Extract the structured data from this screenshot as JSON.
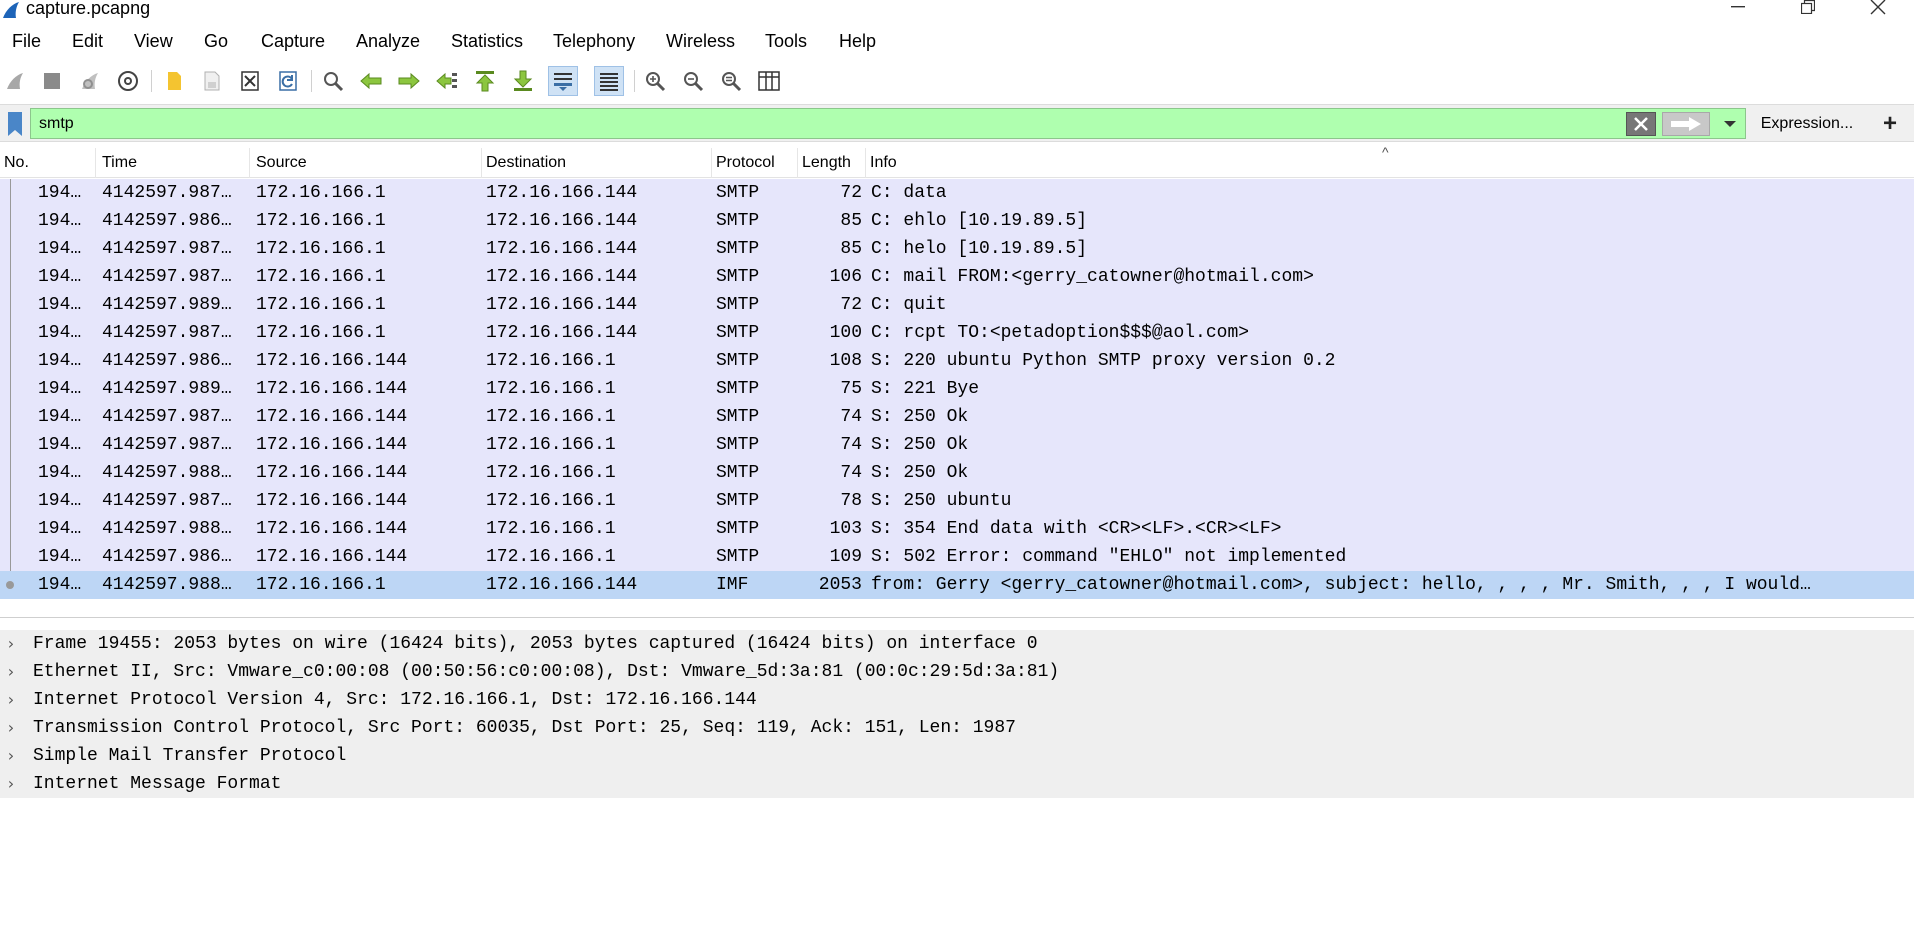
{
  "window": {
    "title": "capture.pcapng",
    "minimize_icon": "minimize-icon",
    "maximize_icon": "restore-icon",
    "close_icon": "close-icon"
  },
  "menu": [
    "File",
    "Edit",
    "View",
    "Go",
    "Capture",
    "Analyze",
    "Statistics",
    "Telephony",
    "Wireless",
    "Tools",
    "Help"
  ],
  "toolbar": {
    "icons": [
      "start-capture-icon",
      "stop-capture-icon",
      "restart-capture-icon",
      "capture-options-icon",
      "open-file-icon",
      "save-file-icon",
      "close-file-icon",
      "reload-file-icon",
      "find-packet-icon",
      "go-back-icon",
      "go-forward-icon",
      "go-to-packet-icon",
      "first-packet-icon",
      "last-packet-icon",
      "auto-scroll-icon",
      "colorize-icon",
      "zoom-in-icon",
      "zoom-out-icon",
      "normal-size-icon",
      "resize-columns-icon"
    ]
  },
  "filter": {
    "value": "smtp",
    "expression_label": "Expression...",
    "add_label": "+",
    "background": "#afffaf"
  },
  "packet_list": {
    "columns": [
      "No.",
      "Time",
      "Source",
      "Destination",
      "Protocol",
      "Length",
      "Info"
    ],
    "row_color": "#e6e6fb",
    "selected_color": "#bdd6f5",
    "rows": [
      {
        "no": "194…",
        "time": "4142597.987…",
        "src": "172.16.166.1",
        "dst": "172.16.166.144",
        "proto": "SMTP",
        "len": "72",
        "info": "C: data"
      },
      {
        "no": "194…",
        "time": "4142597.986…",
        "src": "172.16.166.1",
        "dst": "172.16.166.144",
        "proto": "SMTP",
        "len": "85",
        "info": "C: ehlo [10.19.89.5]"
      },
      {
        "no": "194…",
        "time": "4142597.987…",
        "src": "172.16.166.1",
        "dst": "172.16.166.144",
        "proto": "SMTP",
        "len": "85",
        "info": "C: helo [10.19.89.5]"
      },
      {
        "no": "194…",
        "time": "4142597.987…",
        "src": "172.16.166.1",
        "dst": "172.16.166.144",
        "proto": "SMTP",
        "len": "106",
        "info": "C: mail FROM:<gerry_catowner@hotmail.com>"
      },
      {
        "no": "194…",
        "time": "4142597.989…",
        "src": "172.16.166.1",
        "dst": "172.16.166.144",
        "proto": "SMTP",
        "len": "72",
        "info": "C: quit"
      },
      {
        "no": "194…",
        "time": "4142597.987…",
        "src": "172.16.166.1",
        "dst": "172.16.166.144",
        "proto": "SMTP",
        "len": "100",
        "info": "C: rcpt TO:<petadoption$$$@aol.com>"
      },
      {
        "no": "194…",
        "time": "4142597.986…",
        "src": "172.16.166.144",
        "dst": "172.16.166.1",
        "proto": "SMTP",
        "len": "108",
        "info": "S: 220 ubuntu Python SMTP proxy version 0.2"
      },
      {
        "no": "194…",
        "time": "4142597.989…",
        "src": "172.16.166.144",
        "dst": "172.16.166.1",
        "proto": "SMTP",
        "len": "75",
        "info": "S: 221 Bye"
      },
      {
        "no": "194…",
        "time": "4142597.987…",
        "src": "172.16.166.144",
        "dst": "172.16.166.1",
        "proto": "SMTP",
        "len": "74",
        "info": "S: 250 Ok"
      },
      {
        "no": "194…",
        "time": "4142597.987…",
        "src": "172.16.166.144",
        "dst": "172.16.166.1",
        "proto": "SMTP",
        "len": "74",
        "info": "S: 250 Ok"
      },
      {
        "no": "194…",
        "time": "4142597.988…",
        "src": "172.16.166.144",
        "dst": "172.16.166.1",
        "proto": "SMTP",
        "len": "74",
        "info": "S: 250 Ok"
      },
      {
        "no": "194…",
        "time": "4142597.987…",
        "src": "172.16.166.144",
        "dst": "172.16.166.1",
        "proto": "SMTP",
        "len": "78",
        "info": "S: 250 ubuntu"
      },
      {
        "no": "194…",
        "time": "4142597.988…",
        "src": "172.16.166.144",
        "dst": "172.16.166.1",
        "proto": "SMTP",
        "len": "103",
        "info": "S: 354 End data with <CR><LF>.<CR><LF>"
      },
      {
        "no": "194…",
        "time": "4142597.986…",
        "src": "172.16.166.144",
        "dst": "172.16.166.1",
        "proto": "SMTP",
        "len": "109",
        "info": "S: 502 Error: command \"EHLO\" not implemented"
      },
      {
        "no": "194…",
        "time": "4142597.988…",
        "src": "172.16.166.1",
        "dst": "172.16.166.144",
        "proto": "IMF",
        "len": "2053",
        "info": "from: Gerry <gerry_catowner@hotmail.com>, subject: hello, ,   ,   , Mr. Smith,  ,   , I would…",
        "selected": true
      }
    ]
  },
  "details": [
    "Frame 19455: 2053 bytes on wire (16424 bits), 2053 bytes captured (16424 bits) on interface 0",
    "Ethernet II, Src: Vmware_c0:00:08 (00:50:56:c0:00:08), Dst: Vmware_5d:3a:81 (00:0c:29:5d:3a:81)",
    "Internet Protocol Version 4, Src: 172.16.166.1, Dst: 172.16.166.144",
    "Transmission Control Protocol, Src Port: 60035, Dst Port: 25, Seq: 119, Ack: 151, Len: 1987",
    "Simple Mail Transfer Protocol",
    "Internet Message Format"
  ]
}
